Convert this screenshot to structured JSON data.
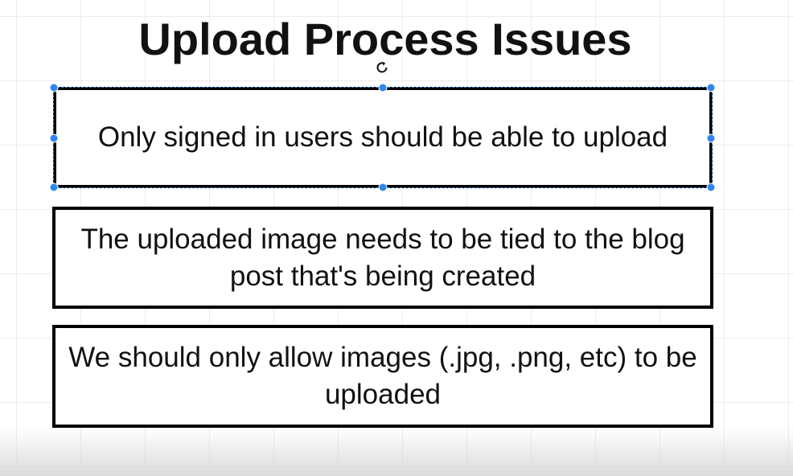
{
  "diagram": {
    "title": "Upload Process Issues",
    "boxes": [
      {
        "text": "Only signed in users should be able to upload",
        "selected": true
      },
      {
        "text": "The uploaded image needs to be tied to the blog post that's being created",
        "selected": false
      },
      {
        "text": "We should only allow images (.jpg, .png, etc) to be uploaded",
        "selected": false
      }
    ]
  },
  "colors": {
    "selection_handle": "#2f86ef",
    "box_border": "#000000",
    "text": "#111111"
  },
  "icons": {
    "rotate": "rotate-icon"
  }
}
